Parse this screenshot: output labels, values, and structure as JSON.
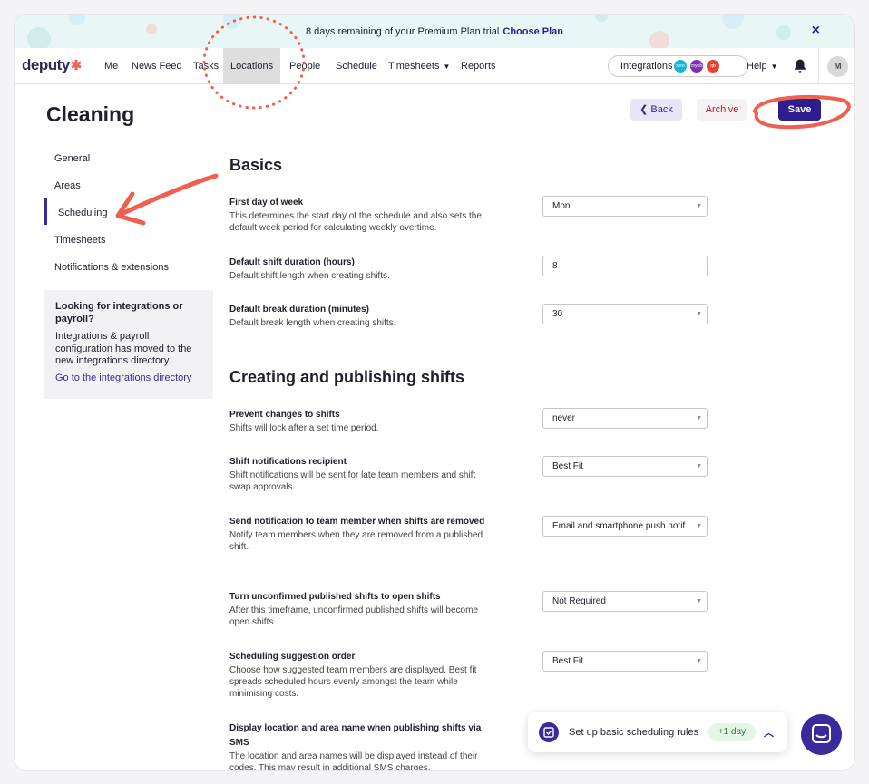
{
  "banner": {
    "message": "8 days remaining of your Premium Plan trial",
    "cta": "Choose Plan",
    "close": "×"
  },
  "nav": {
    "logo": "deputy",
    "items": [
      "Me",
      "News Feed",
      "Tasks",
      "Locations",
      "People",
      "Schedule",
      "Timesheets",
      "Reports"
    ],
    "integrations": "Integrations",
    "integration_badges": [
      "xero",
      "myob",
      "qb"
    ],
    "help": "Help",
    "avatar": "M"
  },
  "page": {
    "title": "Cleaning",
    "back": "Back",
    "archive": "Archive",
    "save": "Save"
  },
  "sidebar": {
    "items": [
      "General",
      "Areas",
      "Scheduling",
      "Timesheets",
      "Notifications & extensions"
    ],
    "active": "Scheduling",
    "info": {
      "heading": "Looking for integrations or payroll?",
      "body": "Integrations & payroll configuration has moved to the new integrations directory.",
      "link": "Go to the integrations directory"
    }
  },
  "sections": {
    "basics": "Basics",
    "publishing": "Creating and publishing shifts"
  },
  "settings": [
    {
      "label": "First day of week",
      "desc": "This determines the start day of the schedule and also sets the default week period for calculating weekly overtime.",
      "value": "Mon",
      "type": "select"
    },
    {
      "label": "Default shift duration (hours)",
      "desc": "Default shift length when creating shifts.",
      "value": "8",
      "type": "input"
    },
    {
      "label": "Default break duration (minutes)",
      "desc": "Default break length when creating shifts.",
      "value": "30",
      "type": "select"
    },
    {
      "label": "Prevent changes to shifts",
      "desc": "Shifts will lock after a set time period.",
      "value": "never",
      "type": "select"
    },
    {
      "label": "Shift notifications recipient",
      "desc": "Shift notifications will be sent for late team members and shift swap approvals.",
      "value": "Best Fit",
      "type": "select"
    },
    {
      "label": "Send notification to team member when shifts are removed",
      "desc": "Notify team members when they are removed from a published shift.",
      "value": "Email and smartphone push notif",
      "type": "select"
    },
    {
      "label": "Turn unconfirmed published shifts to open shifts",
      "desc": "After this timeframe, unconfirmed published shifts will become open shifts.",
      "value": "Not Required",
      "type": "select"
    },
    {
      "label": "Scheduling suggestion order",
      "desc": "Choose how suggested team members are displayed. Best fit spreads scheduled hours evenly amongst the team while minimising costs.",
      "value": "Best Fit",
      "type": "select"
    },
    {
      "label": "Display location and area name when publishing shifts via SMS",
      "desc": "The location and area names will be displayed instead of their codes. This may result in additional SMS charges.",
      "value": "",
      "type": "none"
    }
  ],
  "toast": {
    "text": "Set up basic scheduling rules",
    "badge": "+1 day"
  },
  "colors": {
    "primary": "#2d1e8e",
    "annotation": "#f0604f",
    "archive": "#a31f2c"
  }
}
